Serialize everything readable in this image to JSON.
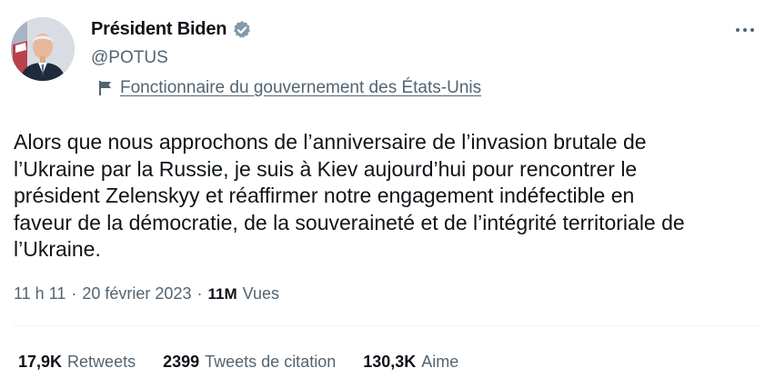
{
  "author": {
    "display_name": "Président Biden",
    "handle": "@POTUS",
    "verified_badge": "government-verified-badge-icon",
    "badge_color": "#829aab",
    "affiliation_icon": "flag-icon",
    "affiliation": "Fonctionnaire du gouvernement des États-Unis"
  },
  "menu": {
    "icon": "more-options-icon"
  },
  "tweet": {
    "text": "Alors que nous approchons de l’anniversaire de l’invasion brutale de\nl’Ukraine par la Russie, je suis à Kiev aujourd’hui pour rencontrer le\nprésident Zelenskyy et réaffirmer notre engagement indéfectible en\nfaveur de la démocratie, de la souveraineté et de l’intégrité territoriale de\nl’Ukraine."
  },
  "meta": {
    "time": "11 h 11",
    "separator": "·",
    "date": "20 février 2023",
    "views_count": "11M",
    "views_label": "Vues"
  },
  "stats": {
    "retweets_count": "17,9K",
    "retweets_label": "Retweets",
    "quotes_count": "2399",
    "quotes_label": "Tweets de citation",
    "likes_count": "130,3K",
    "likes_label": "Aime"
  },
  "colors": {
    "text_primary": "#0f1419",
    "text_secondary": "#536471",
    "divider": "#eff3f4"
  }
}
